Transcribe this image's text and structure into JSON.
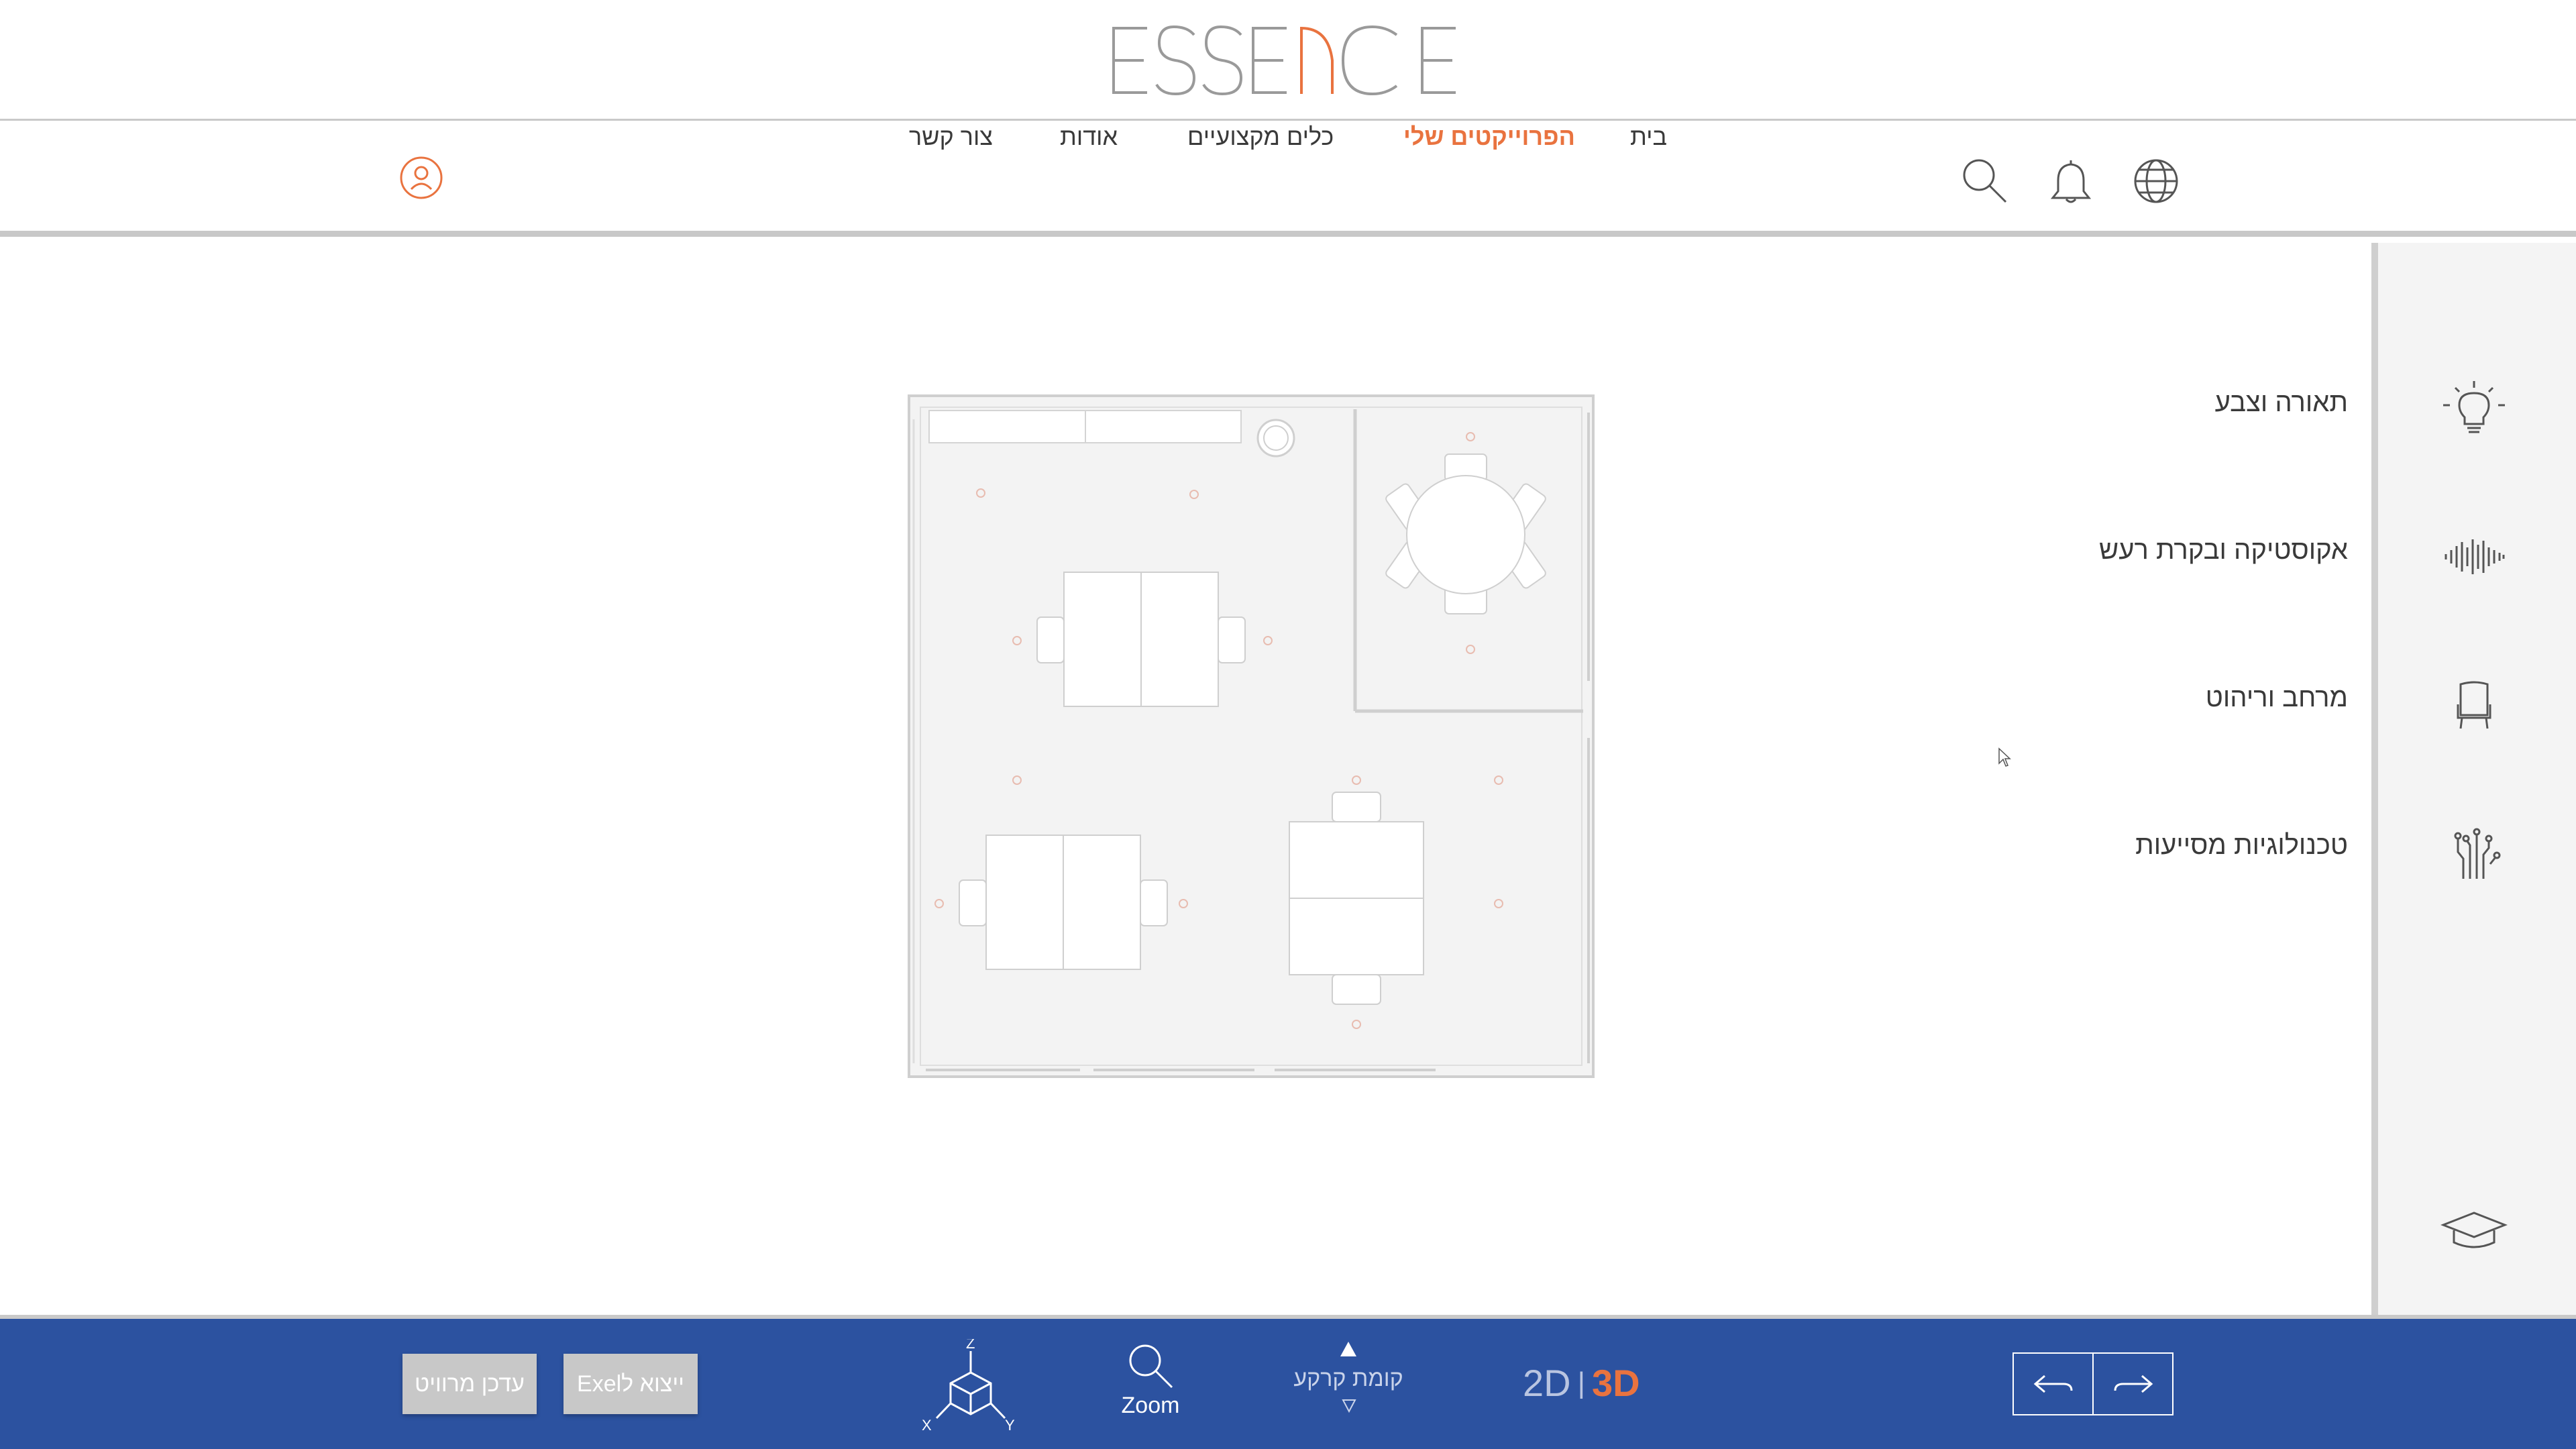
{
  "brand": {
    "logo_text": "ESSENCE",
    "accent_color": "#e9733f",
    "logo_color": "#9a9a9a"
  },
  "nav": {
    "links": [
      {
        "id": "home",
        "label": "בית",
        "active": false
      },
      {
        "id": "projects",
        "label": "הפרוייקטים שלי",
        "active": true
      },
      {
        "id": "tools",
        "label": "כלים מקצועיים",
        "active": false
      },
      {
        "id": "about",
        "label": "אודות",
        "active": false
      },
      {
        "id": "contact",
        "label": "צור קשר",
        "active": false
      }
    ],
    "icons": [
      "globe-icon",
      "bell-icon",
      "search-icon"
    ],
    "user_icon": "user-icon"
  },
  "side_panel": {
    "items": [
      {
        "label": "תאורה וצבע",
        "icon": "lightbulb-icon"
      },
      {
        "label": "אקוסטיקה ובקרת רעש",
        "icon": "soundwave-icon"
      },
      {
        "label": "מרחב וריהוט",
        "icon": "chair-icon"
      },
      {
        "label": "טכנולוגיות מסייעות",
        "icon": "circuit-hand-icon"
      }
    ],
    "bottom_icon": "graduation-cap-icon"
  },
  "toolbar": {
    "export_excel_label": "ייצוא לExel",
    "update_furniture_label": "עדכן מרוויט",
    "zoom_label": "Zoom",
    "floor_label": "קומת קרקע",
    "view_2d_label": "2D",
    "view_separator": "|",
    "view_3d_label": "3D",
    "active_view": "3D",
    "axes": {
      "z": "Z",
      "x": "X",
      "y": "Y"
    },
    "background_color": "#2c52a0"
  }
}
